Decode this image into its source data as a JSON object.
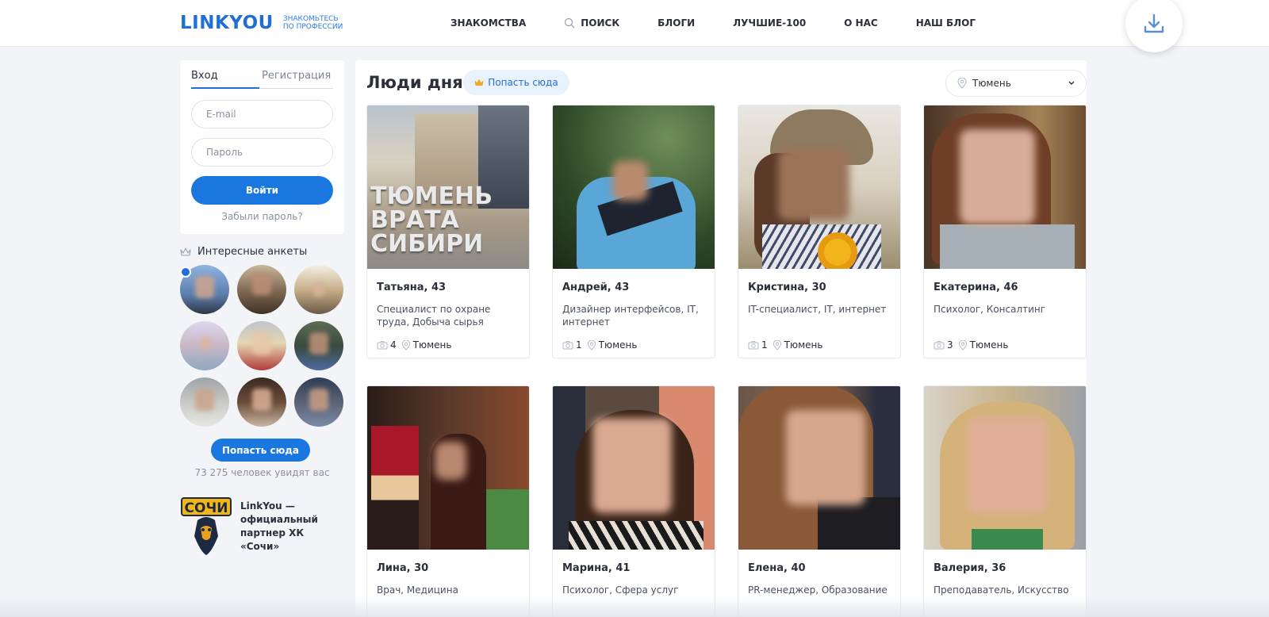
{
  "header": {
    "logo": "LINKYOU",
    "tagline_line1": "ЗНАКОМЬТЕСЬ",
    "tagline_line2": "ПО ПРОФЕССИИ",
    "nav": [
      "ЗНАКОМСТВА",
      "ПОИСК",
      "БЛОГИ",
      "ЛУЧШИЕ-100",
      "О НАС",
      "НАШ БЛОГ"
    ]
  },
  "login": {
    "tab_login": "Вход",
    "tab_register": "Регистрация",
    "email_placeholder": "E-mail",
    "password_placeholder": "Пароль",
    "submit": "Войти",
    "forgot": "Забыли пароль?"
  },
  "sidebar": {
    "interesting_title": "Интересные анкеты",
    "get_here_button": "Попасть сюда",
    "seen_text": "73 275 человек увидят вас",
    "partner_logo_text": "СОЧИ",
    "partner_text": "LinkYou — официальный партнер ХК «Сочи»"
  },
  "main": {
    "title": "Люди дня",
    "get_here_pill": "Попасть сюда",
    "city": "Тюмень",
    "profiles": [
      {
        "name": "Татьяна, 43",
        "job": "Специалист по охране труда, Добыча сырья",
        "photos": "4",
        "city": "Тюмень"
      },
      {
        "name": "Андрей, 43",
        "job": "Дизайнер интерфейсов, IT, интернет",
        "photos": "1",
        "city": "Тюмень"
      },
      {
        "name": "Кристина, 30",
        "job": "IT-специалист, IT, интернет",
        "photos": "1",
        "city": "Тюмень"
      },
      {
        "name": "Екатерина, 46",
        "job": "Психолог, Консалтинг",
        "photos": "3",
        "city": "Тюмень"
      },
      {
        "name": "Лина, 30",
        "job": "Врач, Медицина",
        "photos": "",
        "city": ""
      },
      {
        "name": "Марина, 41",
        "job": "Психолог, Сфера услуг",
        "photos": "",
        "city": ""
      },
      {
        "name": "Елена, 40",
        "job": "PR-менеджер, Образование",
        "photos": "",
        "city": ""
      },
      {
        "name": "Валерия, 36",
        "job": "Преподаватель, Искусство",
        "photos": "",
        "city": ""
      }
    ],
    "photo_text": {
      "line1": "ТЮМЕНЬ",
      "line2": "ВРАТА",
      "line3": "СИБИРИ"
    }
  },
  "colors": {
    "accent": "#1a77e0",
    "background": "#f2f4f8"
  }
}
